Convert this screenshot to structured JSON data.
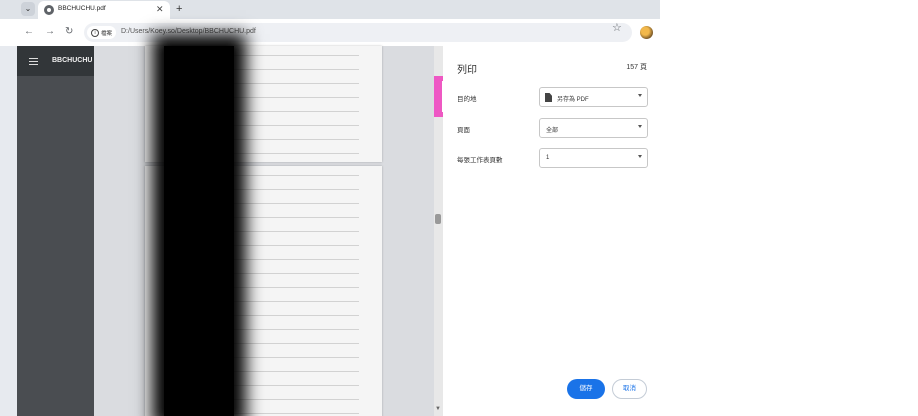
{
  "browser": {
    "tab": {
      "title": "BBCHUCHU.pdf",
      "close_glyph": "✕"
    },
    "new_tab_glyph": "+",
    "tab_menu_glyph": "⌄",
    "nav": {
      "back": "←",
      "forward": "→",
      "reload": "↻"
    },
    "omnibox": {
      "site_chip_label": "檔案",
      "url": "D:/Users/Koey.so/Desktop/BBCHUCHU.pdf"
    },
    "star_glyph": "☆"
  },
  "viewer": {
    "title": "BBCHUCHU"
  },
  "print_panel": {
    "title": "列印",
    "page_count": "157 頁",
    "destination": {
      "label": "目的地",
      "value": "另存為 PDF",
      "icon": "document-icon"
    },
    "pages": {
      "label": "頁面",
      "value": "全部"
    },
    "pages_per_sheet": {
      "label": "每張工作表頁數",
      "value": "1"
    },
    "save_button": "儲存",
    "cancel_button": "取消"
  },
  "colors": {
    "accent": "#1a73e8",
    "highlight_gradient": [
      "#ee56c6",
      "#f3c15a",
      "#f6cf46"
    ],
    "viewer_header": "#323639"
  }
}
